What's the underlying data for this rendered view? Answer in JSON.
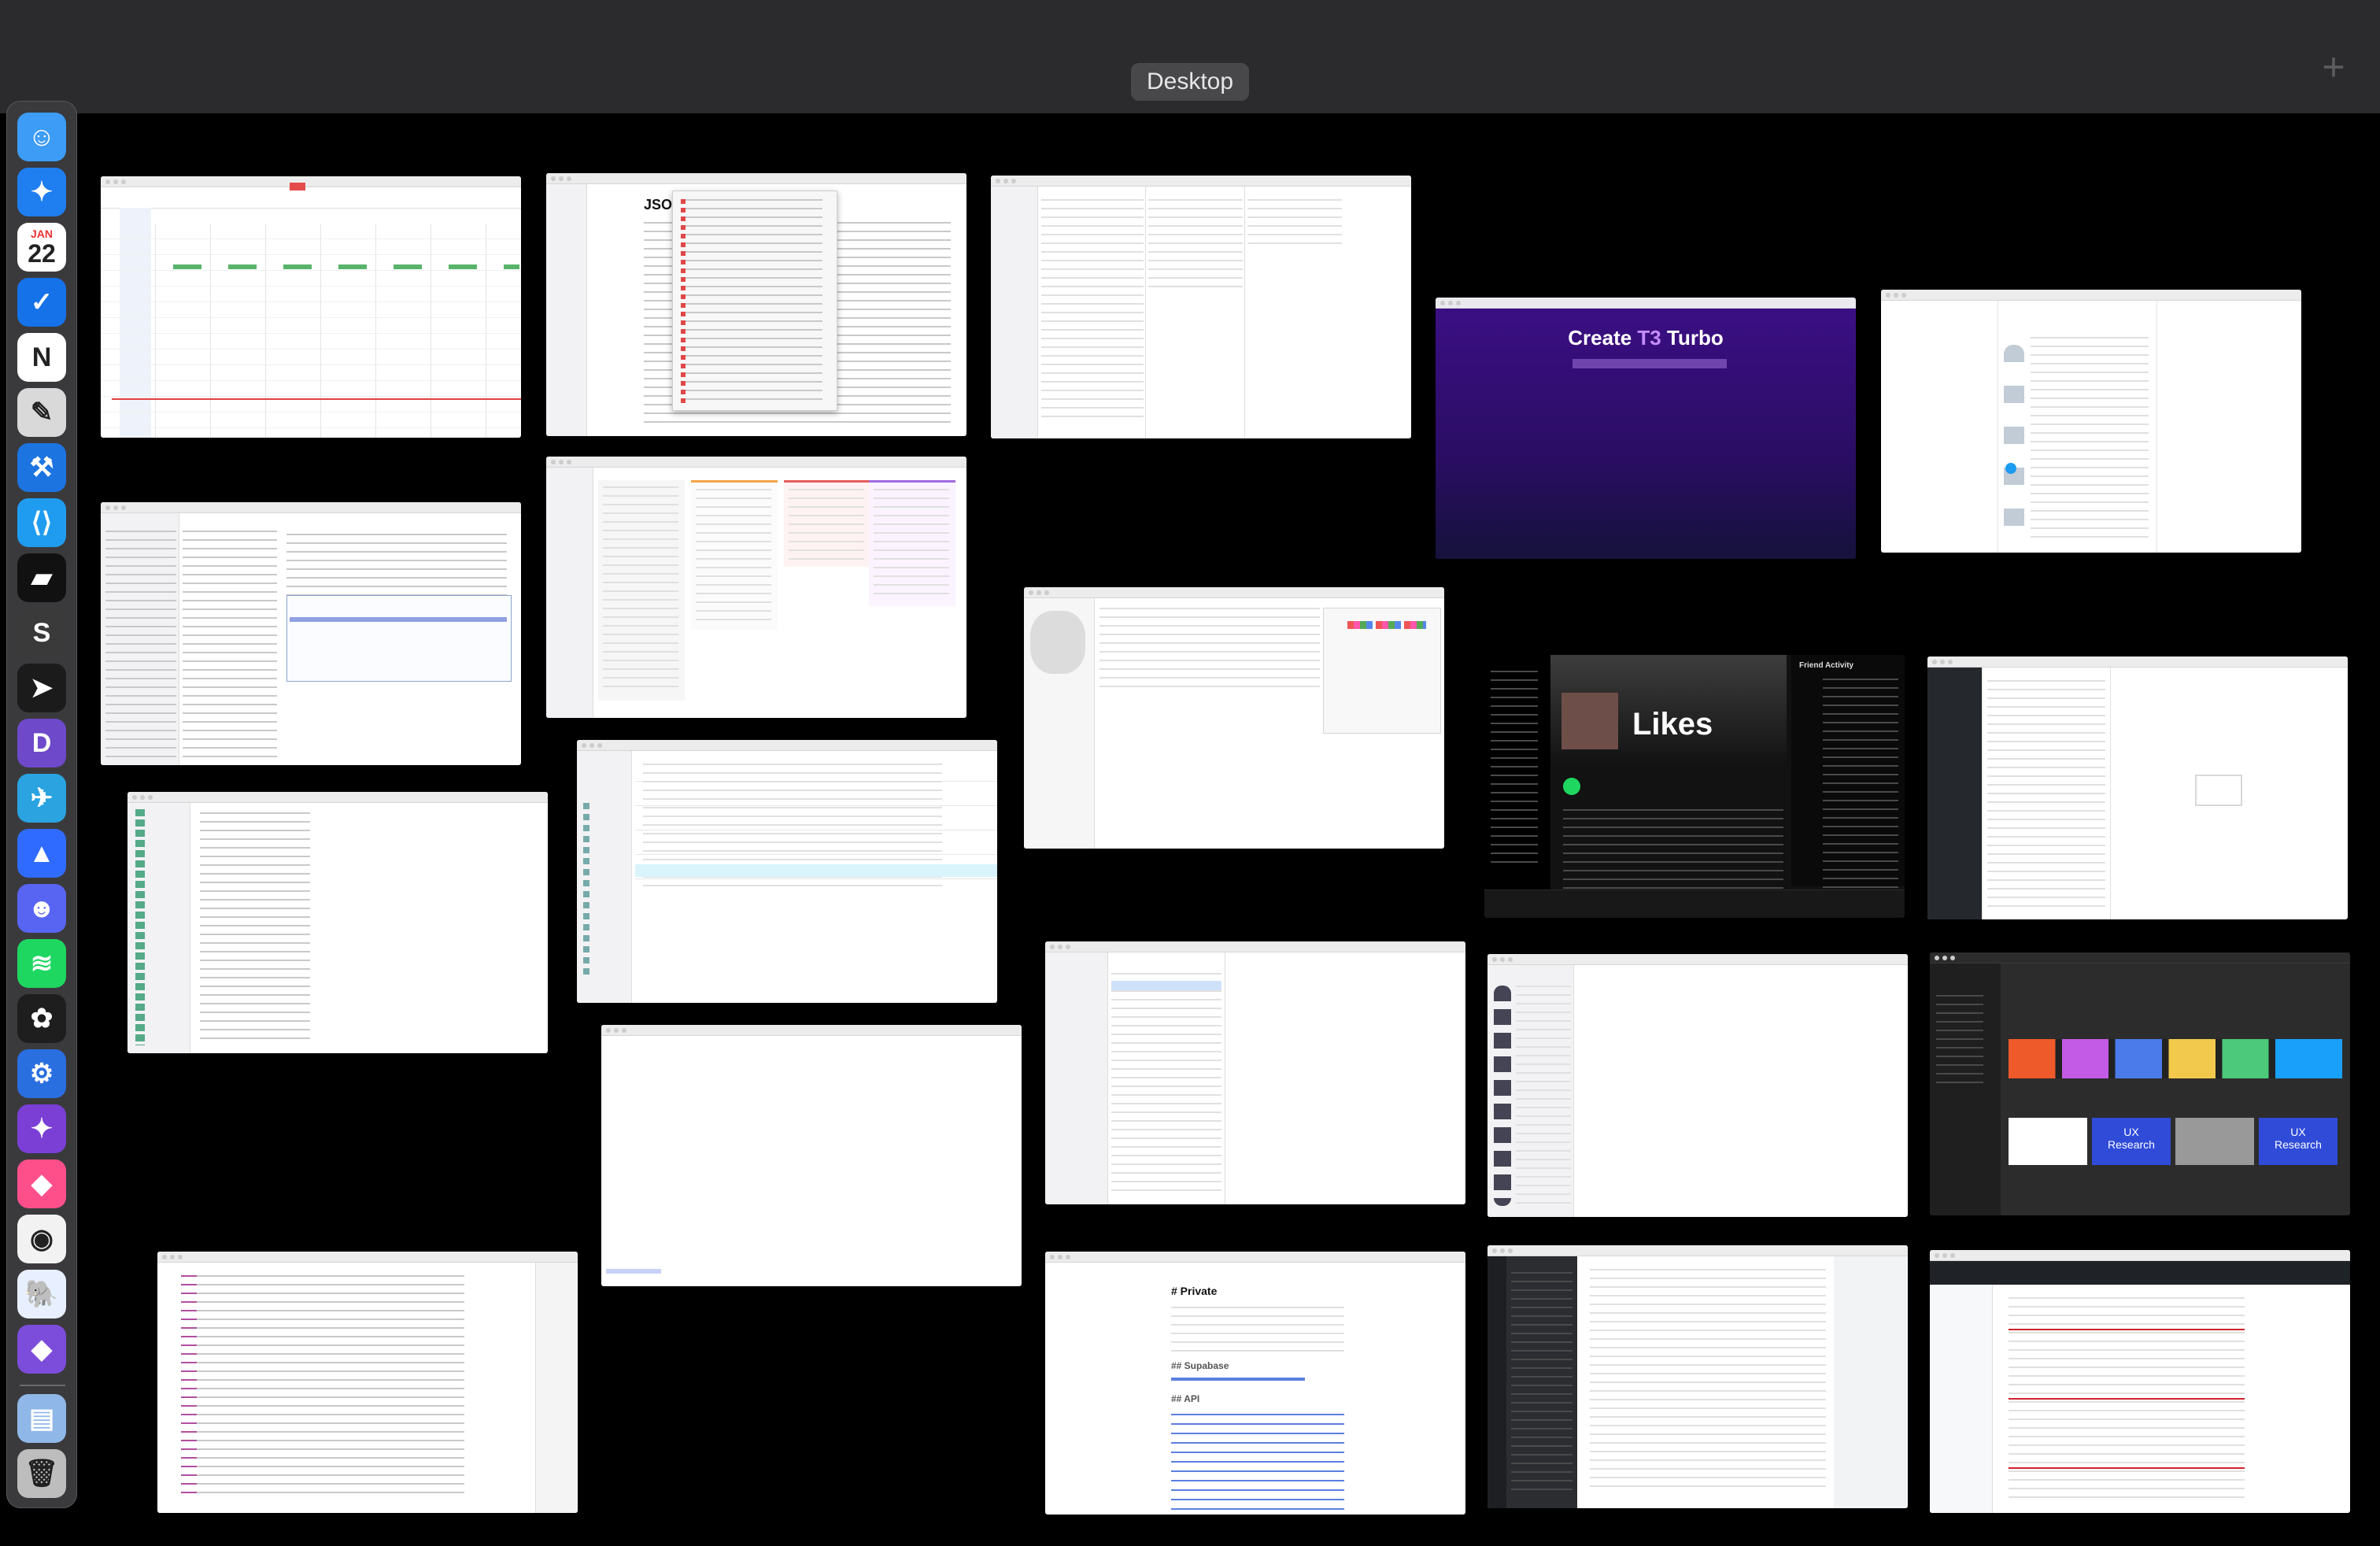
{
  "mission_control": {
    "space_label": "Desktop",
    "add_space_symbol": "+"
  },
  "dock": {
    "items": [
      {
        "name": "finder-icon",
        "color": "#3d9cf5"
      },
      {
        "name": "safari-icon",
        "color": "#1f7ef0"
      },
      {
        "name": "calendar-icon",
        "color": "#ffffff",
        "month": "JAN",
        "day": "22"
      },
      {
        "name": "things-icon",
        "color": "#1672e8"
      },
      {
        "name": "notion-icon",
        "color": "#ffffff"
      },
      {
        "name": "preview-icon",
        "color": "#d9d9d9"
      },
      {
        "name": "xcode-icon",
        "color": "#1c74e0"
      },
      {
        "name": "vscode-icon",
        "color": "#1f9cf0"
      },
      {
        "name": "warp-icon",
        "color": "#111111"
      },
      {
        "name": "sublime-text-icon",
        "color": "#3a3a3a"
      },
      {
        "name": "cursor-icon",
        "color": "#1b1b1b"
      },
      {
        "name": "dash-icon",
        "color": "#6e49c9"
      },
      {
        "name": "telegram-icon",
        "color": "#2aa3e0"
      },
      {
        "name": "arc-icon",
        "color": "#2f6bff"
      },
      {
        "name": "discord-icon",
        "color": "#5865f2"
      },
      {
        "name": "spotify-icon",
        "color": "#1ed760"
      },
      {
        "name": "figma-icon",
        "color": "#1e1e1e"
      },
      {
        "name": "instruments-icon",
        "color": "#2a6fe0"
      },
      {
        "name": "safari-technology-preview-icon",
        "color": "#7b3fd6"
      },
      {
        "name": "shortcuts-icon",
        "color": "#ff4f8b"
      },
      {
        "name": "chrome-icon",
        "color": "#f2f2f2"
      },
      {
        "name": "tableplus-icon",
        "color": "#e8f0ff"
      },
      {
        "name": "obsidian-icon",
        "color": "#7c4ddb"
      },
      {
        "name": "downloads-stack-icon",
        "color": "#8fb8e8"
      },
      {
        "name": "trash-icon",
        "color": "#bdbdbd"
      }
    ]
  },
  "windows": {
    "t3": {
      "title_a": "Create ",
      "title_b": "T3",
      "title_c": " Turbo"
    },
    "spotify": {
      "heading": "Likes",
      "activity": "Friend Activity"
    },
    "notes": {
      "h_private": "# Private",
      "h_supabase": "## Supabase",
      "h_api": "## API"
    },
    "figma": {
      "card_a": "UX\nResearch",
      "card_b": "UX\nResearch"
    },
    "doc": {
      "heading": "JSON"
    }
  },
  "colors": {
    "t3_bg": "#2e1065",
    "t3_accent": "#c58cff",
    "spotify_bg": "#121212",
    "spotify_green": "#1ed760",
    "figma_dark": "#2c2c2c"
  }
}
